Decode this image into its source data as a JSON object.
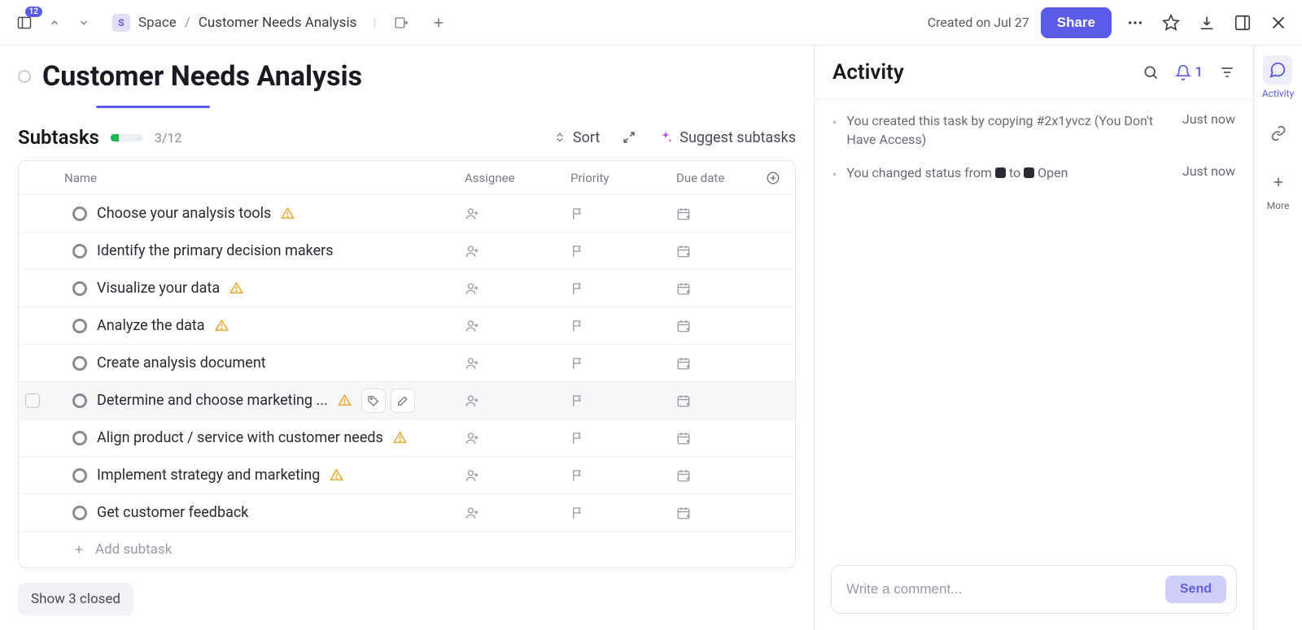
{
  "topbar": {
    "sidebar_badge": "12",
    "space_letter": "S",
    "space_label": "Space",
    "page_title": "Customer Needs Analysis",
    "created": "Created on Jul 27",
    "share": "Share"
  },
  "main": {
    "title": "Customer Needs Analysis",
    "subtasks_label": "Subtasks",
    "progress_text": "3/12",
    "progress_pct": 25,
    "sort_label": "Sort",
    "suggest_label": "Suggest subtasks",
    "columns": {
      "name": "Name",
      "assignee": "Assignee",
      "priority": "Priority",
      "due": "Due date"
    },
    "rows": [
      {
        "name": "Choose your analysis tools",
        "warn": true,
        "hover": false
      },
      {
        "name": "Identify the primary decision makers",
        "warn": false,
        "hover": false
      },
      {
        "name": "Visualize your data",
        "warn": true,
        "hover": false
      },
      {
        "name": "Analyze the data",
        "warn": true,
        "hover": false
      },
      {
        "name": "Create analysis document",
        "warn": false,
        "hover": false
      },
      {
        "name": "Determine and choose marketing ...",
        "warn": true,
        "hover": true
      },
      {
        "name": "Align product / service with customer needs",
        "warn": true,
        "hover": false
      },
      {
        "name": "Implement strategy and marketing",
        "warn": true,
        "hover": false
      },
      {
        "name": "Get customer feedback",
        "warn": false,
        "hover": false
      }
    ],
    "add_subtask": "Add subtask",
    "show_closed": "Show 3 closed"
  },
  "activity": {
    "title": "Activity",
    "bell_count": "1",
    "items": [
      {
        "text_pre": "You created this task by copying #2x1yvcz (You Don't Have Access)",
        "time": "Just now",
        "status": false
      },
      {
        "text_pre": "You changed status from ",
        "text_post": " Open",
        "time": "Just now",
        "status": true
      }
    ],
    "comment_placeholder": "Write a comment...",
    "send": "Send"
  },
  "rail": {
    "activity": "Activity",
    "more": "More"
  }
}
